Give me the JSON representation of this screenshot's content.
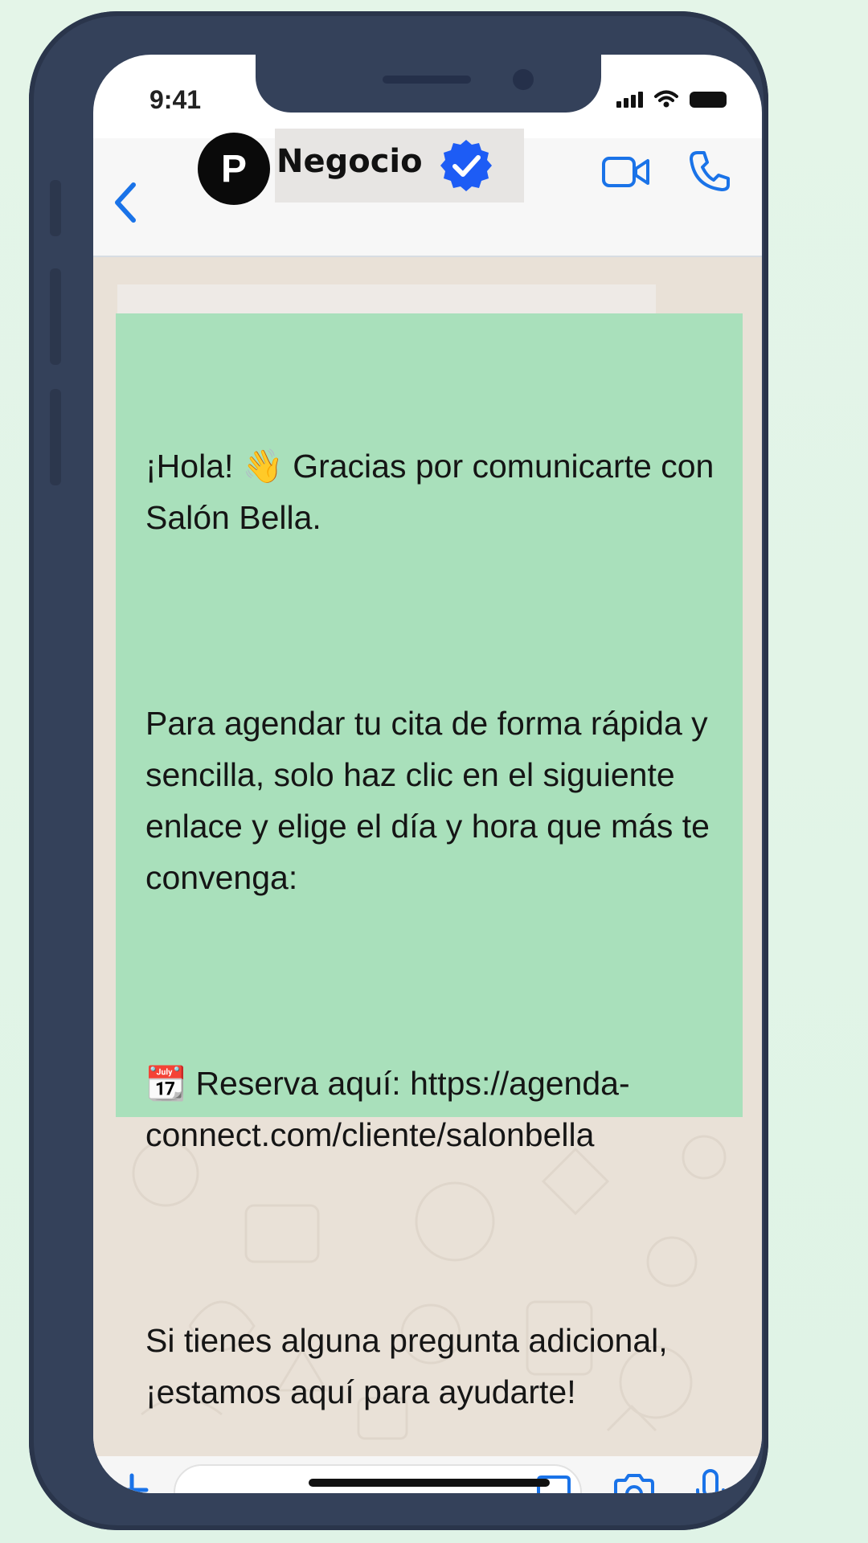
{
  "status": {
    "time": "9:41"
  },
  "header": {
    "avatar_letter": "P",
    "contact_name": "Negocio",
    "verified": true,
    "icons": [
      "back-chevron-icon",
      "verified-badge-icon",
      "video-call-icon",
      "phone-call-icon"
    ]
  },
  "chat": {
    "message": {
      "p1": "¡Hola! 👋 Gracias por comunicarte con Salón Bella.",
      "p2": "Para agendar tu cita de forma rápida y sencilla, solo haz clic en el siguiente enlace y elige el día y hora que más te convenga:",
      "p3": "📆 Reserva aquí: https://agenda-connect.com/cliente/salonbella",
      "p4": "Si tienes alguna pregunta adicional, ¡estamos aquí para ayudarte!"
    }
  },
  "input_bar": {
    "placeholder": "",
    "icons": [
      "plus-icon",
      "sticker-icon",
      "camera-icon",
      "microphone-icon"
    ]
  },
  "colors": {
    "accent": "#1a73e8",
    "bubble": "#a9e0bb",
    "chat_background": "#e9e1d7",
    "phone_frame": "#34415a",
    "page_background": "#e2f4e7"
  }
}
